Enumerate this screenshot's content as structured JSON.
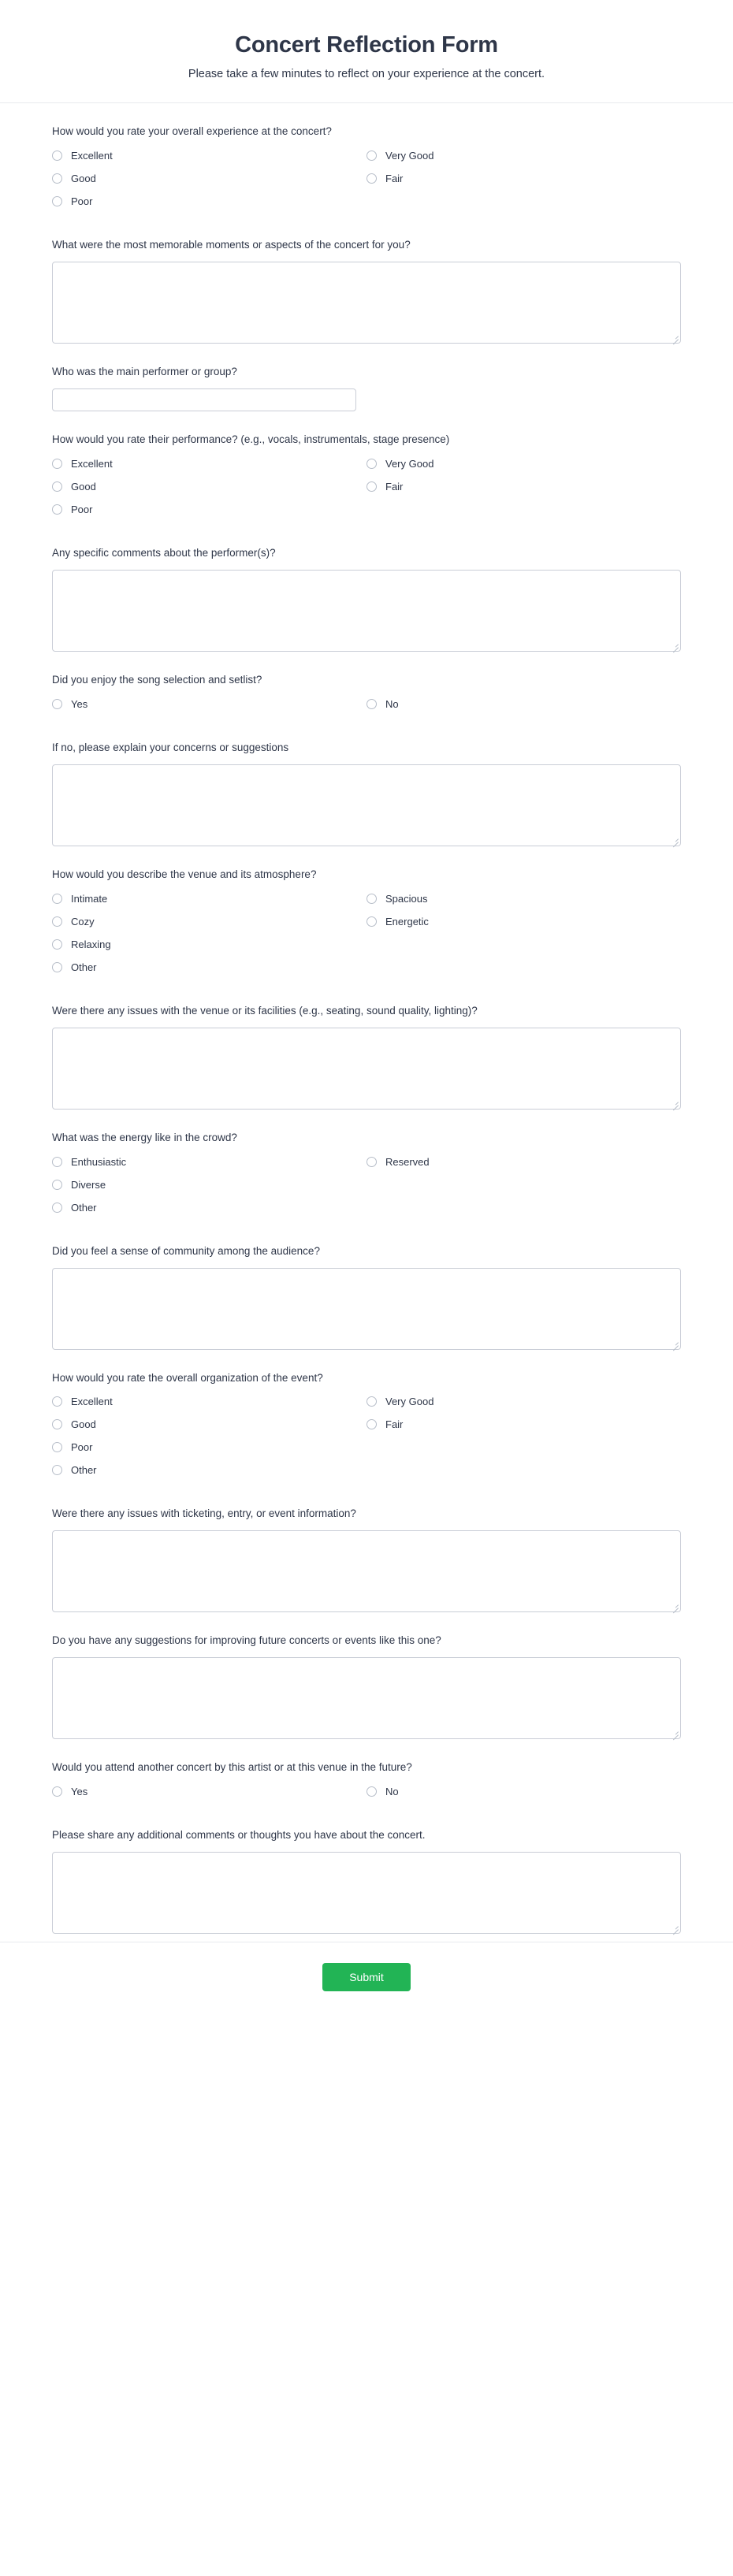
{
  "header": {
    "title": "Concert Reflection Form",
    "subtitle": "Please take a few minutes to reflect on your experience at the concert."
  },
  "theme": {
    "submit_color": "#22b455",
    "text_color": "#2e3648",
    "border_color": "#c9cdd6",
    "radio_border_color": "#b6bdc8",
    "divider_color": "#e8eaee"
  },
  "fields": [
    {
      "id": "overall-experience",
      "label": "How would you rate your overall experience at the concert?",
      "type": "radio",
      "rows": 3,
      "options": [
        "Excellent",
        "Good",
        "Poor",
        "Very Good",
        "Fair"
      ]
    },
    {
      "id": "memorable-moments",
      "label": "What were the most memorable moments or aspects of the concert for you?",
      "type": "textarea",
      "value": "",
      "placeholder": ""
    },
    {
      "id": "main-performer",
      "label": "Who was the main performer or group?",
      "type": "text",
      "value": "",
      "placeholder": ""
    },
    {
      "id": "performance-rating",
      "label": "How would you rate their performance? (e.g., vocals, instrumentals, stage presence)",
      "type": "radio",
      "rows": 3,
      "options": [
        "Excellent",
        "Good",
        "Poor",
        "Very Good",
        "Fair"
      ]
    },
    {
      "id": "performer-comments",
      "label": "Any specific comments about the performer(s)?",
      "type": "textarea",
      "value": "",
      "placeholder": ""
    },
    {
      "id": "song-selection",
      "label": "Did you enjoy the song selection and setlist?",
      "type": "radio",
      "rows": 1,
      "options": [
        "Yes",
        "No"
      ]
    },
    {
      "id": "setlist-concerns",
      "label": "If no, please explain your concerns or suggestions",
      "type": "textarea",
      "value": "",
      "placeholder": ""
    },
    {
      "id": "venue-atmosphere",
      "label": "How would you describe the venue and its atmosphere?",
      "type": "radio",
      "rows": 4,
      "options": [
        "Intimate",
        "Cozy",
        "Relaxing",
        "Other",
        "Spacious",
        "Energetic"
      ]
    },
    {
      "id": "venue-issues",
      "label": "Were there any issues with the venue or its facilities (e.g., seating, sound quality, lighting)?",
      "type": "textarea",
      "value": "",
      "placeholder": ""
    },
    {
      "id": "crowd-energy",
      "label": "What was the energy like in the crowd?",
      "type": "radio",
      "rows": 3,
      "options": [
        "Enthusiastic",
        "Diverse",
        "Other",
        "Reserved"
      ]
    },
    {
      "id": "sense-of-community",
      "label": "Did you feel a sense of community among the audience?",
      "type": "textarea",
      "value": "",
      "placeholder": ""
    },
    {
      "id": "event-organization",
      "label": "How would you rate the overall organization of the event?",
      "type": "radio",
      "rows": 4,
      "options": [
        "Excellent",
        "Good",
        "Poor",
        "Other",
        "Very Good",
        "Fair"
      ]
    },
    {
      "id": "ticketing-issues",
      "label": "Were there any issues with ticketing, entry, or event information?",
      "type": "textarea",
      "value": "",
      "placeholder": ""
    },
    {
      "id": "future-suggestions",
      "label": "Do you have any suggestions for improving future concerts or events like this one?",
      "type": "textarea",
      "value": "",
      "placeholder": ""
    },
    {
      "id": "attend-again",
      "label": "Would you attend another concert by this artist or at this venue in the future?",
      "type": "radio",
      "rows": 1,
      "options": [
        "Yes",
        "No"
      ]
    },
    {
      "id": "additional-comments",
      "label": "Please share any additional comments or thoughts you have about the concert.",
      "type": "textarea",
      "value": "",
      "placeholder": ""
    }
  ],
  "footer": {
    "submit_label": "Submit"
  }
}
